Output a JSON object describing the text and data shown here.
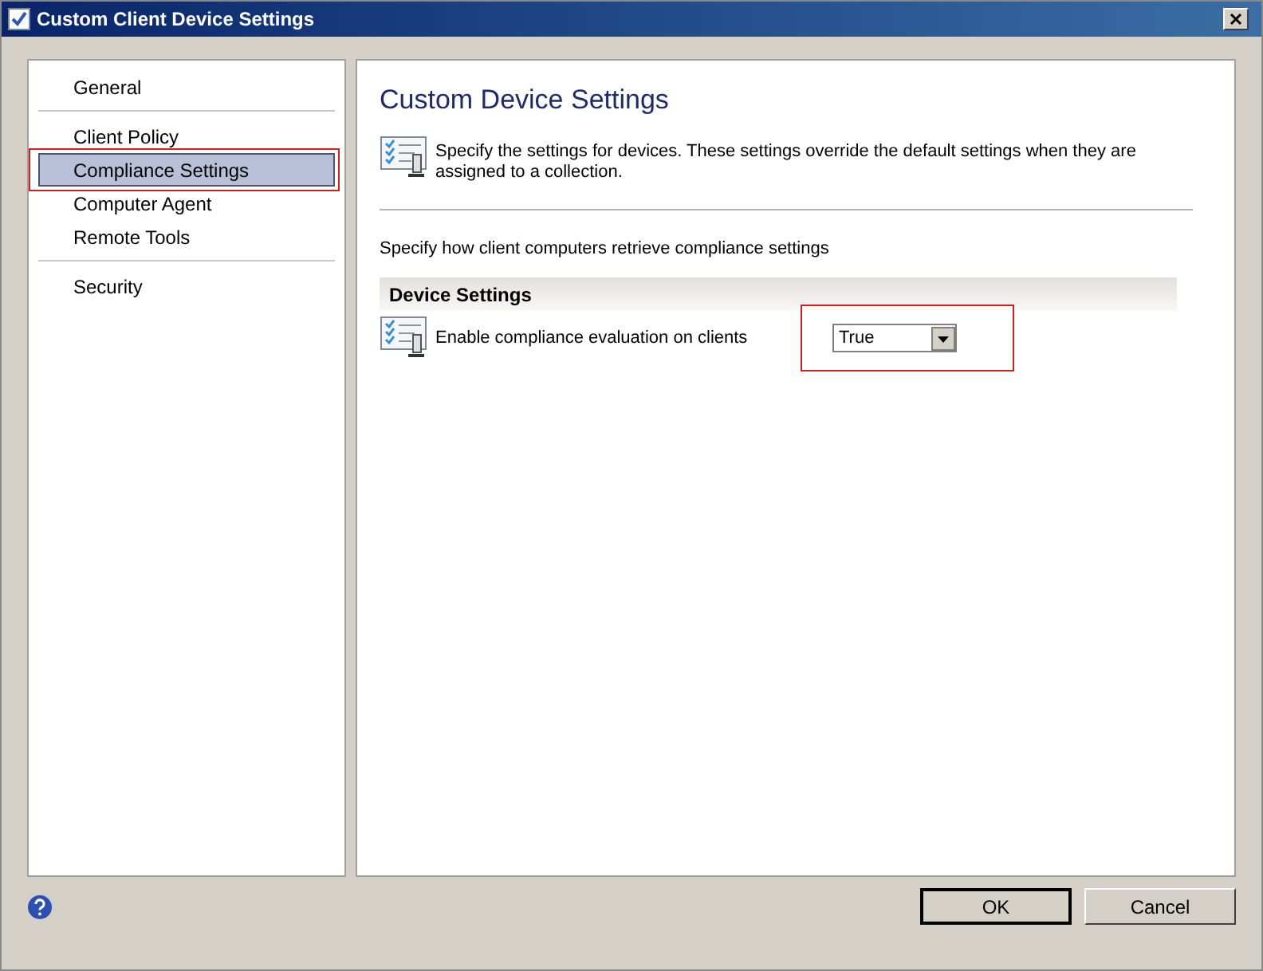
{
  "window": {
    "title": "Custom Client Device Settings"
  },
  "sidebar": {
    "groups": [
      {
        "items": [
          {
            "label": "General",
            "selected": false,
            "highlighted": false
          }
        ]
      },
      {
        "items": [
          {
            "label": "Client Policy",
            "selected": false,
            "highlighted": false
          },
          {
            "label": "Compliance Settings",
            "selected": true,
            "highlighted": true
          },
          {
            "label": "Computer Agent",
            "selected": false,
            "highlighted": false
          },
          {
            "label": "Remote Tools",
            "selected": false,
            "highlighted": false
          }
        ]
      },
      {
        "items": [
          {
            "label": "Security",
            "selected": false,
            "highlighted": false
          }
        ]
      }
    ]
  },
  "content": {
    "title": "Custom Device Settings",
    "description": "Specify the settings for devices. These settings override the default settings when they are assigned to a collection.",
    "instruction": "Specify how client computers retrieve compliance settings",
    "section": {
      "title": "Device Settings",
      "settings": [
        {
          "label": "Enable compliance evaluation on clients",
          "value": "True",
          "highlighted": true
        }
      ]
    }
  },
  "buttons": [
    {
      "label": "OK",
      "default": true
    },
    {
      "label": "Cancel",
      "default": false
    }
  ]
}
